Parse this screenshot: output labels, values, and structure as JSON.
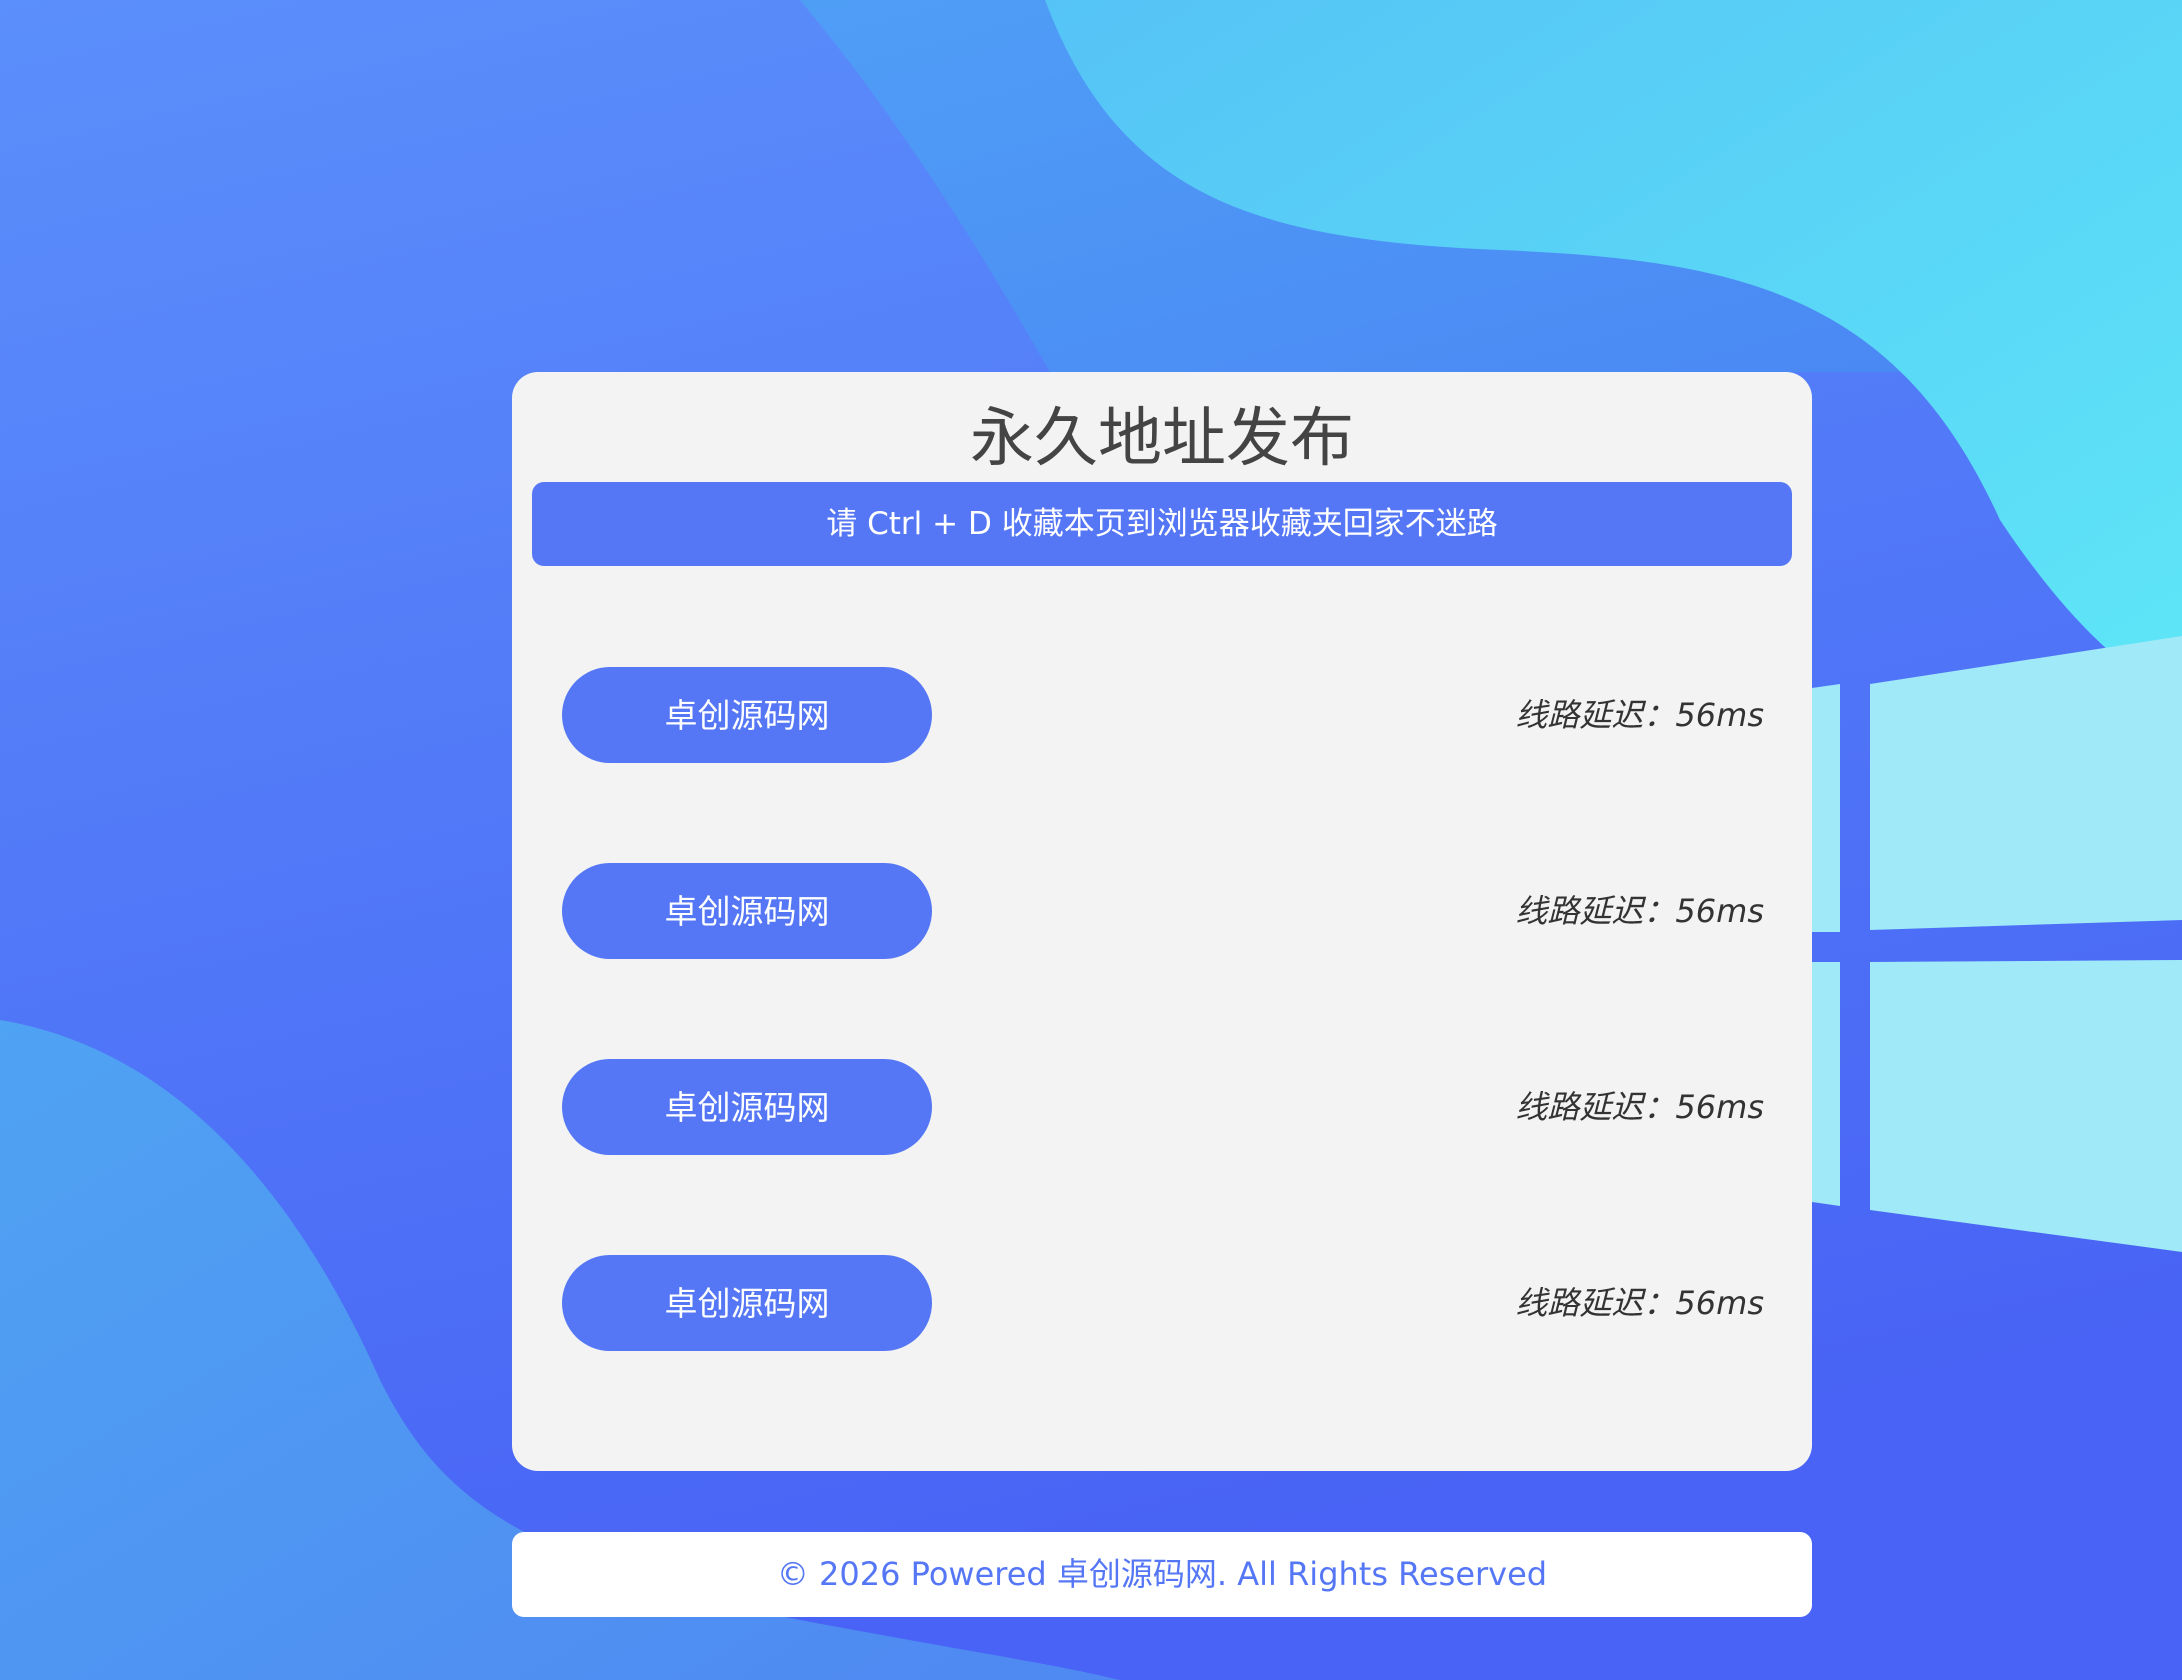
{
  "colors": {
    "background": "#4a6cf7",
    "card": "#f3f3f3",
    "accent": "#5577f5",
    "title_text": "#444444",
    "latency_text": "#333333",
    "footer_text": "#5577f5"
  },
  "card": {
    "title": "永久地址发布",
    "notice": "请 Ctrl + D 收藏本页到浏览器收藏夹回家不迷路"
  },
  "routes": [
    {
      "label": "卓创源码网",
      "latency": "线路延迟：56ms"
    },
    {
      "label": "卓创源码网",
      "latency": "线路延迟：56ms"
    },
    {
      "label": "卓创源码网",
      "latency": "线路延迟：56ms"
    },
    {
      "label": "卓创源码网",
      "latency": "线路延迟：56ms"
    }
  ],
  "footer": {
    "text": "© 2026 Powered 卓创源码网. All Rights Reserved"
  }
}
